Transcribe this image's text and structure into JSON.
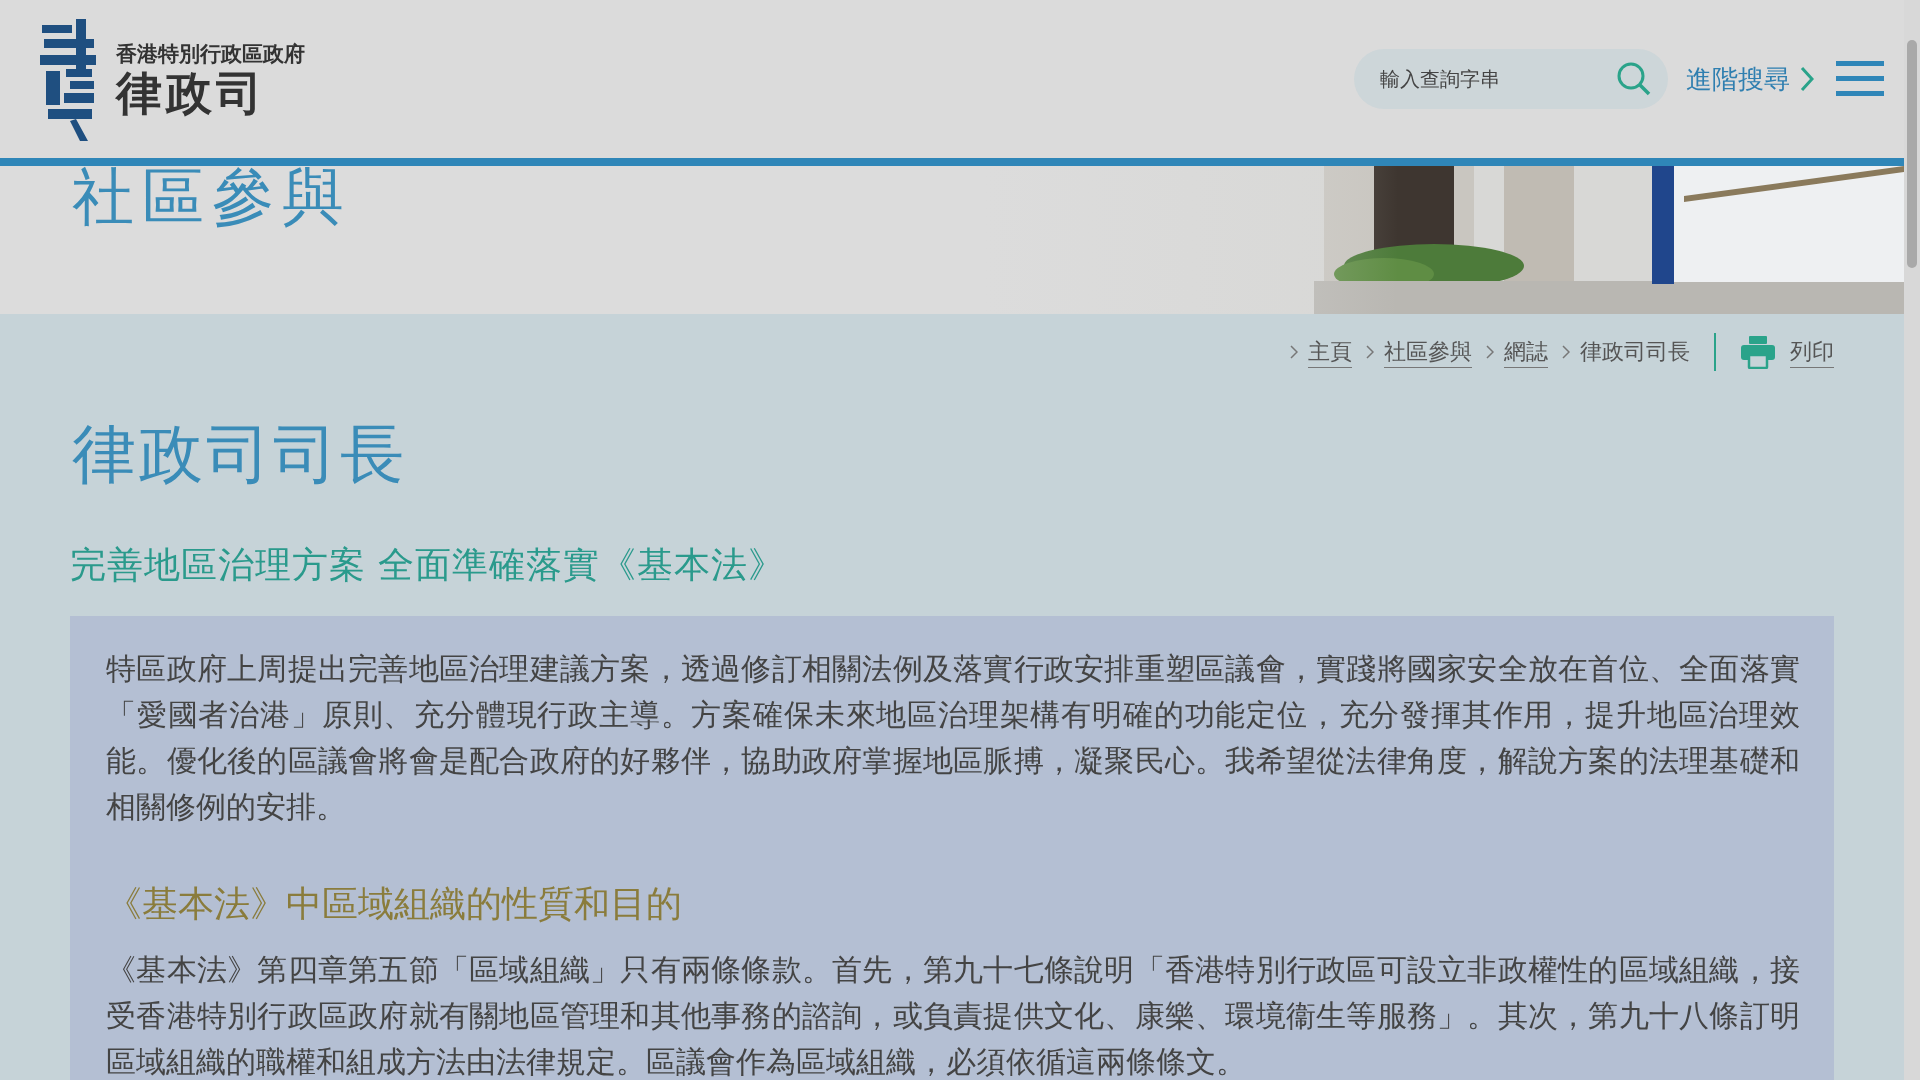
{
  "header": {
    "logo_subtitle": "香港特別行政區政府",
    "logo_title": "律政司",
    "search": {
      "placeholder": "輸入查詢字串"
    },
    "advanced_search": "進階搜尋"
  },
  "banner": {
    "title": "社區參與",
    "kind": "picture"
  },
  "breadcrumb": [
    {
      "label": "主頁",
      "link": true
    },
    {
      "label": "社區參與",
      "link": true
    },
    {
      "label": "網誌",
      "link": true
    },
    {
      "label": "律政司司長",
      "link": false
    }
  ],
  "print": "列印",
  "page_title": "律政司司長",
  "article": {
    "title": "完善地區治理方案 全面準確落實《基本法》",
    "blocks": [
      {
        "kind": "paragraph",
        "text": "特區政府上周提出完善地區治理建議方案，透過修訂相關法例及落實行政安排重塑區議會，實踐將國家安全放在首位、全面落實「愛國者治港」原則、充分體現行政主導。方案確保未來地區治理架構有明確的功能定位，充分發揮其作用，提升地區治理效能。優化後的區議會將會是配合政府的好夥伴，協助政府掌握地區脈搏，凝聚民心。我希望從法律角度，解說方案的法理基礎和相關修例的安排。"
      },
      {
        "kind": "heading",
        "text": "《基本法》中區域組織的性質和目的"
      },
      {
        "kind": "paragraph",
        "text": "《基本法》第四章第五節「區域組織」只有兩條條款。首先，第九十七條說明「香港特別行政區可設立非政權性的區域組織，接受香港特別行政區政府就有關地區管理和其他事務的諮詢，或負責提供文化、康樂、環境衞生等服務」。其次，第九十八條訂明區域組織的職權和組成方法由法律規定。區議會作為區域組織，必須依循這兩條條文。"
      }
    ]
  }
}
